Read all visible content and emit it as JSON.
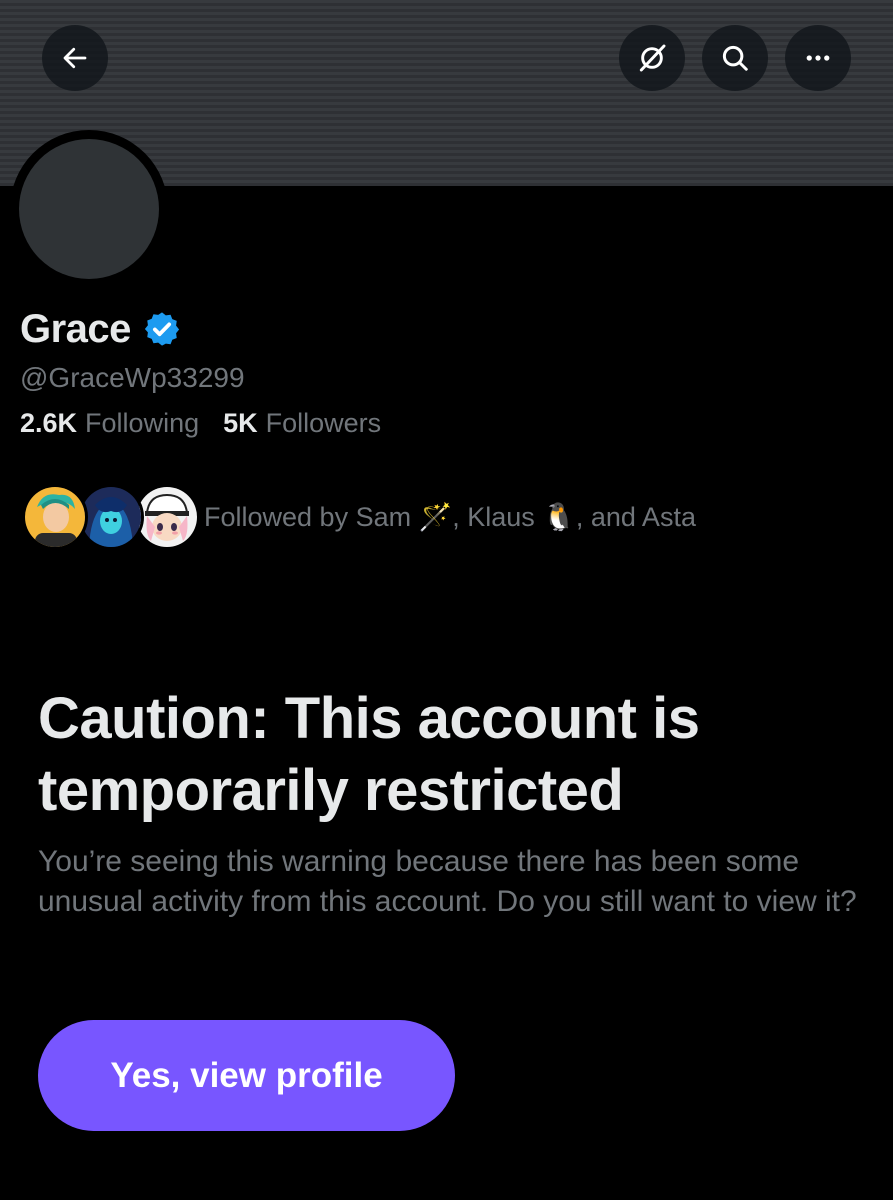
{
  "profile": {
    "display_name": "Grace",
    "handle": "@GraceWp33299",
    "following_count": "2.6K",
    "following_label": "Following",
    "followers_count": "5K",
    "followers_label": "Followers",
    "followed_by_text": "Followed by Sam 🪄, Klaus 🐧, and Asta",
    "verified_color": "#1d9bf0"
  },
  "header": {
    "icons": [
      "back-arrow-icon",
      "grok-icon",
      "search-icon",
      "more-icon"
    ]
  },
  "warning": {
    "title": "Caution: This account is temporarily restricted",
    "body": "You’re seeing this warning because there has been some unusual activity from this account. Do you still want to view it?",
    "button_label": "Yes, view profile",
    "button_color": "#7856ff"
  }
}
